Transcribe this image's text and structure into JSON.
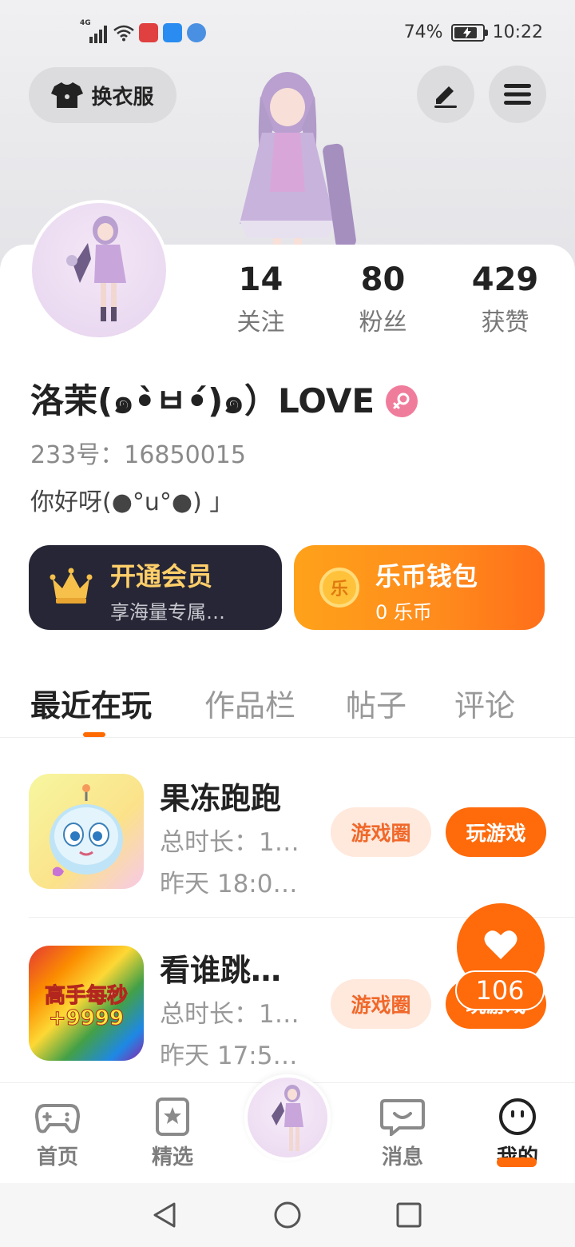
{
  "status_bar": {
    "network": "4G",
    "battery": "74%",
    "battery_level": 0.74,
    "time": "10:22"
  },
  "header": {
    "dress_button_label": "换衣服"
  },
  "profile": {
    "stats": [
      {
        "value": "14",
        "label": "关注"
      },
      {
        "value": "80",
        "label": "粉丝"
      },
      {
        "value": "429",
        "label": "获赞"
      }
    ],
    "username": "洛茉(๑•̀ㅂ•́)๑）LOVE",
    "uid": "233号：16850015",
    "bio": "你好呀(●°u°●) 」"
  },
  "cards": {
    "vip": {
      "title": "开通会员",
      "subtitle": "享海量专属…"
    },
    "wallet": {
      "title": "乐币钱包",
      "subtitle": "0 乐币",
      "coin_glyph": "乐"
    }
  },
  "tabs": [
    {
      "label": "最近在玩",
      "active": true
    },
    {
      "label": "作品栏",
      "active": false
    },
    {
      "label": "帖子",
      "active": false
    },
    {
      "label": "评论",
      "active": false
    }
  ],
  "games": [
    {
      "name": "果冻跑跑",
      "duration": "总时长：1…",
      "last_played": "昨天 18:0…",
      "circle_label": "游戏圈",
      "play_label": "玩游戏"
    },
    {
      "name": "看谁跳…",
      "duration": "总时长：1…",
      "last_played": "昨天 17:5…",
      "circle_label": "游戏圈",
      "play_label": "玩游戏",
      "icon_text_line1": "高手每秒",
      "icon_text_line2": "+9999"
    }
  ],
  "like": {
    "count": "106"
  },
  "bottom_nav": [
    {
      "label": "首页",
      "icon": "gamepad-icon",
      "active": false
    },
    {
      "label": "精选",
      "icon": "star-icon",
      "active": false
    },
    {
      "label": "消息",
      "icon": "chat-icon",
      "active": false
    },
    {
      "label": "我的",
      "icon": "smile-icon",
      "active": true
    }
  ],
  "colors": {
    "accent": "#ff6a0a",
    "vip_bg": "#262636",
    "vip_title": "#ffcf6a",
    "circle_pill_bg": "#ffe8dc",
    "gender_female": "#f07c9c"
  }
}
